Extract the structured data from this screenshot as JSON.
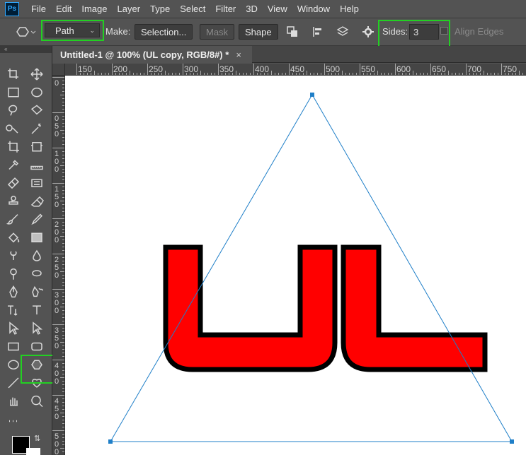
{
  "app": {
    "logo": "Ps"
  },
  "menu": [
    "File",
    "Edit",
    "Image",
    "Layer",
    "Type",
    "Select",
    "Filter",
    "3D",
    "View",
    "Window",
    "Help"
  ],
  "options": {
    "tool_mode": "Path",
    "make_label": "Make:",
    "selection_button": "Selection...",
    "mask_button": "Mask",
    "shape_button": "Shape",
    "sides_label": "Sides:",
    "sides_value": "3",
    "align_edges_label": "Align Edges"
  },
  "document": {
    "tab_title": "Untitled-1 @ 100% (UL copy, RGB/8#) *",
    "close_glyph": "×"
  },
  "ruler": {
    "horizontal": [
      "150",
      "200",
      "250",
      "300",
      "350",
      "400",
      "450",
      "500",
      "550",
      "600",
      "650",
      "700",
      "750"
    ],
    "vertical": [
      "0",
      "0",
      "5",
      "0",
      "1",
      "0",
      "0",
      "1",
      "5",
      "0",
      "2",
      "0",
      "0",
      "2",
      "5",
      "0",
      "3",
      "0",
      "0",
      "3",
      "5",
      "0",
      "4",
      "0",
      "0",
      "4",
      "5",
      "0",
      "5",
      "0",
      "0"
    ]
  },
  "colors": {
    "accent_green": "#22d022",
    "path_blue": "#1f7fc8",
    "letter_fill": "#ff0000",
    "letter_stroke": "#000000"
  },
  "tools": [
    "artboard-icon",
    "move-icon",
    "rect-marquee-icon",
    "ellipse-marquee-icon",
    "lasso-icon",
    "polygon-lasso-icon",
    "quick-select-icon",
    "magic-wand-icon",
    "crop-icon",
    "frame-icon",
    "eyedropper-icon",
    "ruler-icon",
    "healing-brush-icon",
    "patch-icon",
    "stamp-icon",
    "eraser-icon",
    "brush-icon",
    "pencil-icon",
    "paint-bucket-icon",
    "gradient-icon",
    "smudge-icon",
    "blur-icon",
    "dodge-icon",
    "sponge-icon",
    "pen-icon",
    "freeform-pen-icon",
    "vertical-type-icon",
    "type-icon",
    "path-select-icon",
    "direct-select-icon",
    "rectangle-icon",
    "rounded-rect-icon",
    "ellipse-icon",
    "polygon-icon",
    "line-icon",
    "custom-shape-icon",
    "hand-icon",
    "zoom-icon",
    "more-tools-icon"
  ]
}
